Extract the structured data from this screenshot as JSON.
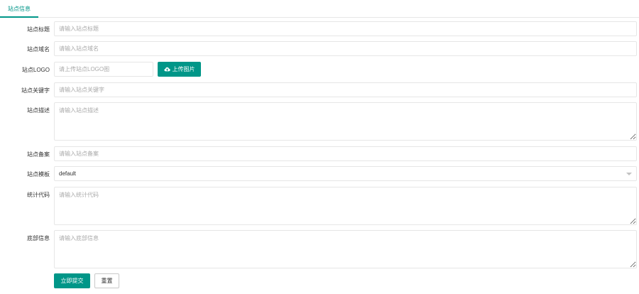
{
  "tabs": [
    {
      "label": "站点信息"
    }
  ],
  "form": {
    "site_title": {
      "label": "站点标题",
      "placeholder": "请输入站点标题"
    },
    "site_domain": {
      "label": "站点域名",
      "placeholder": "请输入站点域名"
    },
    "site_logo": {
      "label": "站点LOGO",
      "placeholder": "请上传站点LOGO图",
      "upload_label": "上传图片",
      "upload_icon": "cloud-upload-icon"
    },
    "site_keywords": {
      "label": "站点关键字",
      "placeholder": "请输入站点关键字"
    },
    "site_description": {
      "label": "站点描述",
      "placeholder": "请输入站点描述"
    },
    "site_icp": {
      "label": "站点备案",
      "placeholder": "请输入站点备案"
    },
    "site_template": {
      "label": "站点模板",
      "value": "default"
    },
    "stats_code": {
      "label": "统计代码",
      "placeholder": "请输入统计代码"
    },
    "footer_info": {
      "label": "底部信息",
      "placeholder": "请输入底部信息"
    }
  },
  "actions": {
    "submit_label": "立即提交",
    "reset_label": "重置"
  },
  "colors": {
    "accent": "#009688",
    "border": "#e6e6e6"
  }
}
